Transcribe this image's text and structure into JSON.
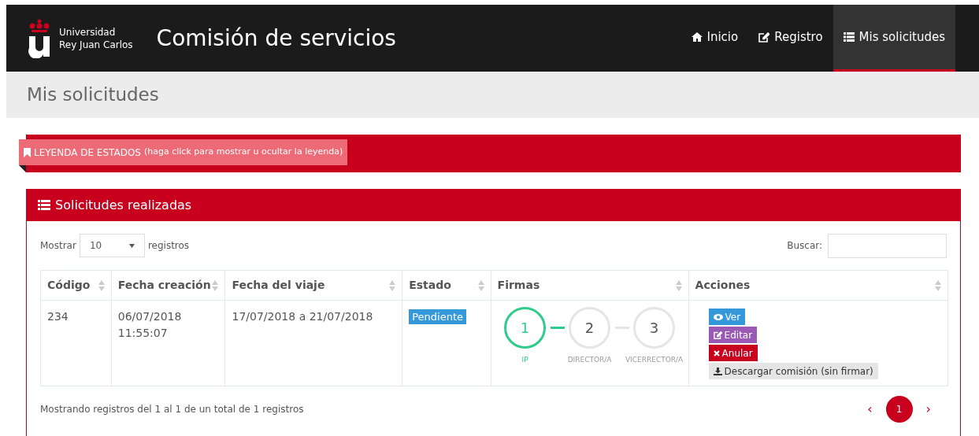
{
  "brand": {
    "line_1": "Universidad",
    "line_2": "Rey Juan Carlos"
  },
  "app_title": "Comisión de servicios",
  "nav": [
    {
      "label": "Inicio",
      "selected": false
    },
    {
      "label": "Registro",
      "selected": false
    },
    {
      "label": "Mis solicitudes",
      "selected": true
    }
  ],
  "page_title": "Mis solicitudes",
  "legend": {
    "label": "LEYENDA DE ESTADOS",
    "hint": "(haga click para mostrar u ocultar la leyenda)"
  },
  "panel": {
    "title": "Solicitudes realizadas",
    "length": {
      "before": "Mostrar",
      "value": "10",
      "after": "registros"
    },
    "search": {
      "label": "Buscar:"
    },
    "table": {
      "columns": [
        "Código",
        "Fecha creación",
        "Fecha del viaje",
        "Estado",
        "Firmas",
        "Acciones"
      ],
      "rows": [
        {
          "code": "234",
          "created": [
            "06/07/2018",
            "11:55:07"
          ],
          "trip": "17/07/2018 a 21/07/2018",
          "status": "Pendiente",
          "signatures": [
            {
              "number": "1",
              "role": "IP",
              "done": true
            },
            {
              "number": "2",
              "role": "DIRECTOR/A",
              "done": false
            },
            {
              "number": "3",
              "role": "VICERRECTOR/A",
              "done": false
            }
          ],
          "actions": [
            {
              "kind": "view",
              "label": "Ver"
            },
            {
              "kind": "edit",
              "label": "Editar"
            },
            {
              "kind": "cancel",
              "label": "Anular"
            },
            {
              "kind": "download",
              "label": "Descargar comisión (sin firmar)"
            }
          ]
        }
      ]
    },
    "info": "Mostrando registros del 1 al 1 de un total de 1 registros",
    "pagination": {
      "prev": "‹",
      "pages": [
        {
          "label": "1",
          "selected": true
        }
      ],
      "next": "›"
    }
  }
}
